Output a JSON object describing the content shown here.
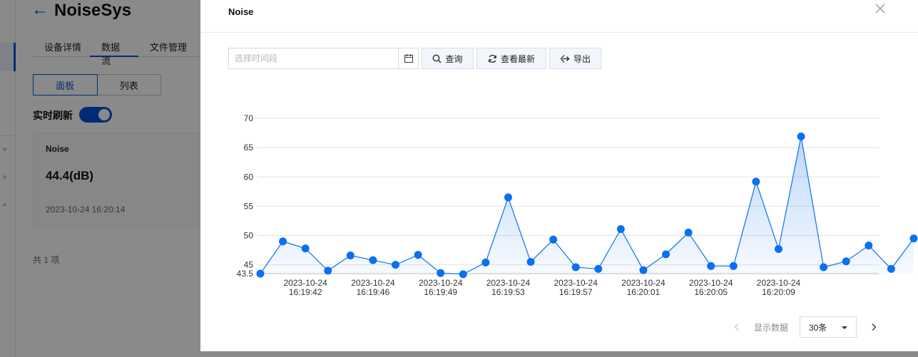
{
  "app": {
    "title": "NoiseSys"
  },
  "tabs": [
    {
      "label": "设备详情"
    },
    {
      "label": "数据流"
    },
    {
      "label": "文件管理"
    }
  ],
  "view_toggle": {
    "panel": "面板",
    "list": "列表",
    "selected": "面板"
  },
  "realtime": {
    "label": "实时刷新",
    "enabled": true
  },
  "card": {
    "title": "Noise",
    "value": "44.4(dB)",
    "time": "2023-10-24 16:20:14"
  },
  "total": "共 1 项",
  "drawer": {
    "title": "Noise",
    "range_placeholder": "选择时间段",
    "query_label": "查询",
    "latest_label": "查看最新",
    "export_label": "导出"
  },
  "pagination": {
    "label": "显示数据",
    "page_size": "30条"
  },
  "colors": {
    "accent": "#0052d9",
    "series": "#0a70f0"
  },
  "chart_data": {
    "type": "area",
    "title": "",
    "xlabel": "",
    "ylabel": "",
    "ylim": [
      43.5,
      70
    ],
    "yticks": [
      70,
      65,
      60,
      55,
      50,
      45,
      43.5
    ],
    "grid": true,
    "x_tick_labels": [
      {
        "index": 2,
        "date": "2023-10-24",
        "time": "16:19:42"
      },
      {
        "index": 5,
        "date": "2023-10-24",
        "time": "16:19:46"
      },
      {
        "index": 8,
        "date": "2023-10-24",
        "time": "16:19:49"
      },
      {
        "index": 11,
        "date": "2023-10-24",
        "time": "16:19:53"
      },
      {
        "index": 14,
        "date": "2023-10-24",
        "time": "16:19:57"
      },
      {
        "index": 17,
        "date": "2023-10-24",
        "time": "16:20:01"
      },
      {
        "index": 20,
        "date": "2023-10-24",
        "time": "16:20:05"
      },
      {
        "index": 23,
        "date": "2023-10-24",
        "time": "16:20:09"
      }
    ],
    "series": [
      {
        "values": [
          43.5,
          49.0,
          47.8,
          44.0,
          46.6,
          45.8,
          45.0,
          46.7,
          43.6,
          43.4,
          45.4,
          56.5,
          45.5,
          49.3,
          44.6,
          44.3,
          51.1,
          44.1,
          46.8,
          50.5,
          44.8,
          44.8,
          59.2,
          47.7,
          66.9,
          44.6,
          45.6,
          48.3,
          44.3,
          49.5
        ]
      }
    ]
  }
}
